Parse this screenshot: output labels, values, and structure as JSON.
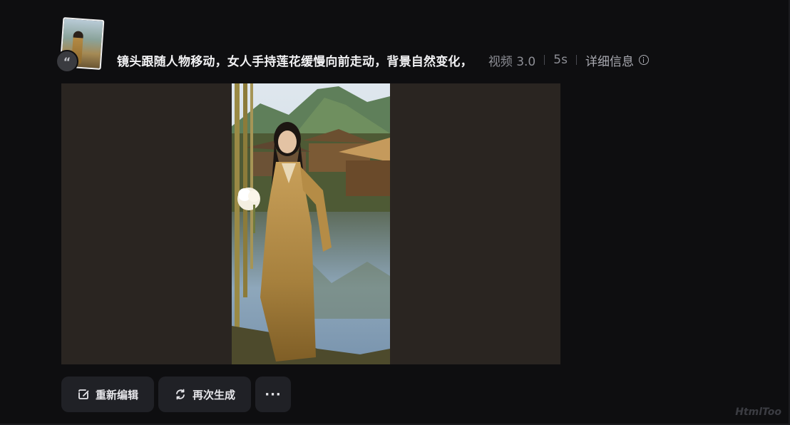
{
  "prompt": {
    "text": "镜头跟随人物移动，女人手持莲花缓慢向前走动，背景自然变化，",
    "model_label": "视频 3.0",
    "duration": "5s",
    "detail_label": "详细信息",
    "quote_icon": "quote-icon",
    "info_icon": "info-icon"
  },
  "actions": {
    "edit_label": "重新编辑",
    "regenerate_label": "再次生成",
    "more_label": "···"
  },
  "watermark": "HtmlToo",
  "colors": {
    "background": "#0e0e10",
    "panel": "#2a2521",
    "button": "#202126",
    "muted_text": "#8d8e95"
  }
}
